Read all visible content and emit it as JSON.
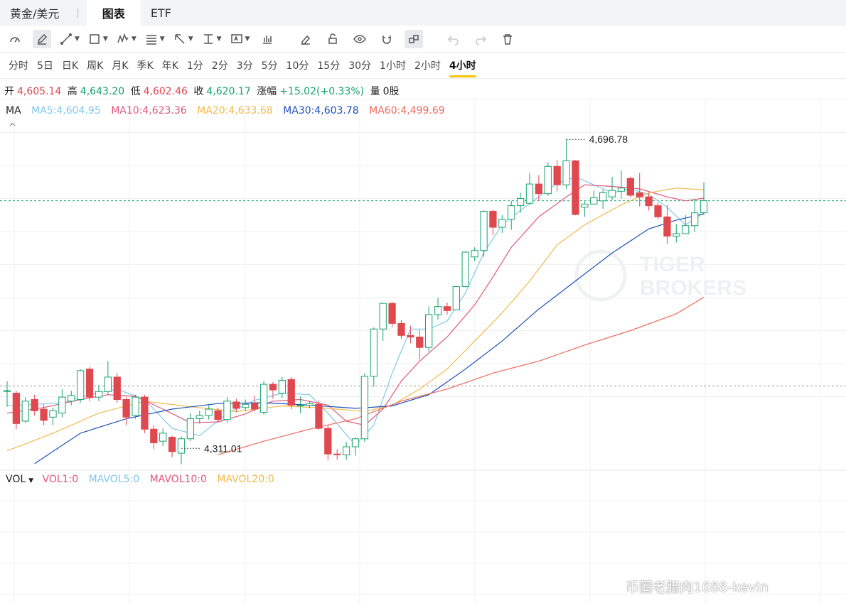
{
  "tabs": [
    {
      "label": "黄金/美元"
    },
    {
      "label": "图表"
    },
    {
      "label": "ETF"
    }
  ],
  "tab_separator": "|",
  "toolbar_icons": [
    "gauge-icon",
    "pencil-icon",
    "trend-line-icon",
    "rectangle-icon",
    "pattern-icon",
    "fib-icon",
    "arrow-icon",
    "measure-icon",
    "text-icon",
    "indicator-icon",
    "eraser-icon",
    "lock-icon",
    "eye-icon",
    "magnet-icon",
    "link-icon",
    "undo-icon",
    "redo-icon",
    "trash-icon"
  ],
  "periods": [
    "分时",
    "5日",
    "日K",
    "周K",
    "月K",
    "季K",
    "年K",
    "1分",
    "2分",
    "3分",
    "5分",
    "10分",
    "15分",
    "30分",
    "1小时",
    "2小时",
    "4小时"
  ],
  "active_period": "4小时",
  "ohlc": {
    "open_label": "开",
    "open": "4,605.14",
    "high_label": "高",
    "high": "4,643.20",
    "low_label": "低",
    "low": "4,602.46",
    "close_label": "收",
    "close": "4,620.17",
    "change_label": "涨幅",
    "change": "+15.02(+0.33%)",
    "volume_label": "量",
    "volume": "0股"
  },
  "ma_legend": {
    "title": "MA",
    "ma5": "MA5:4,604.95",
    "ma10": "MA10:4,623.36",
    "ma20": "MA20:4,633.68",
    "ma30": "MA30:4,603.78",
    "ma60": "MA60:4,499.69"
  },
  "vol_legend": {
    "title": "VOL",
    "vol1": "VOL1:0",
    "mavol5": "MAVOL5:0",
    "mavol10": "MAVOL10:0",
    "mavol20": "MAVOL20:0"
  },
  "collapse_glyph": "^",
  "watermark": "币圈老腊肉1688-kevin",
  "colors": {
    "up": "#16a36c",
    "down": "#e0484f",
    "ma5": "#7fc8ec",
    "ma10": "#e0577a",
    "ma20": "#f2b94d",
    "ma30": "#1d4fb8",
    "ma60": "#ee6b5c",
    "accent": "#f5c400"
  },
  "chart_data": {
    "type": "candlestick",
    "y_range": [
      4290,
      4720
    ],
    "max_label": "4,696.78",
    "min_label": "4,311.01",
    "max_value": 4696.78,
    "min_value": 4311.01,
    "candles": [
      {
        "o": 4383,
        "c": 4383,
        "h": 4395,
        "l": 4363
      },
      {
        "o": 4380,
        "c": 4342,
        "h": 4383,
        "l": 4335
      },
      {
        "o": 4345,
        "c": 4370,
        "h": 4375,
        "l": 4343
      },
      {
        "o": 4372,
        "c": 4358,
        "h": 4378,
        "l": 4352
      },
      {
        "o": 4360,
        "c": 4346,
        "h": 4366,
        "l": 4340
      },
      {
        "o": 4350,
        "c": 4358,
        "h": 4362,
        "l": 4340
      },
      {
        "o": 4355,
        "c": 4375,
        "h": 4385,
        "l": 4350
      },
      {
        "o": 4370,
        "c": 4377,
        "h": 4383,
        "l": 4365
      },
      {
        "o": 4372,
        "c": 4408,
        "h": 4410,
        "l": 4368
      },
      {
        "o": 4410,
        "c": 4375,
        "h": 4413,
        "l": 4370
      },
      {
        "o": 4375,
        "c": 4382,
        "h": 4390,
        "l": 4370
      },
      {
        "o": 4382,
        "c": 4400,
        "h": 4420,
        "l": 4378
      },
      {
        "o": 4400,
        "c": 4372,
        "h": 4405,
        "l": 4368
      },
      {
        "o": 4372,
        "c": 4350,
        "h": 4375,
        "l": 4340
      },
      {
        "o": 4352,
        "c": 4375,
        "h": 4378,
        "l": 4348
      },
      {
        "o": 4375,
        "c": 4335,
        "h": 4378,
        "l": 4330
      },
      {
        "o": 4335,
        "c": 4318,
        "h": 4340,
        "l": 4310
      },
      {
        "o": 4320,
        "c": 4330,
        "h": 4336,
        "l": 4314
      },
      {
        "o": 4325,
        "c": 4307,
        "h": 4327,
        "l": 4300
      },
      {
        "o": 4305,
        "c": 4323,
        "h": 4326,
        "l": 4291
      },
      {
        "o": 4323,
        "c": 4348,
        "h": 4355,
        "l": 4320
      },
      {
        "o": 4348,
        "c": 4352,
        "h": 4358,
        "l": 4342
      },
      {
        "o": 4352,
        "c": 4360,
        "h": 4365,
        "l": 4347
      },
      {
        "o": 4358,
        "c": 4347,
        "h": 4362,
        "l": 4344
      },
      {
        "o": 4347,
        "c": 4370,
        "h": 4375,
        "l": 4343
      },
      {
        "o": 4369,
        "c": 4361,
        "h": 4373,
        "l": 4356
      },
      {
        "o": 4362,
        "c": 4366,
        "h": 4372,
        "l": 4358
      },
      {
        "o": 4367,
        "c": 4360,
        "h": 4377,
        "l": 4357
      },
      {
        "o": 4356,
        "c": 4391,
        "h": 4395,
        "l": 4353
      },
      {
        "o": 4391,
        "c": 4384,
        "h": 4394,
        "l": 4373
      },
      {
        "o": 4380,
        "c": 4396,
        "h": 4400,
        "l": 4374
      },
      {
        "o": 4397,
        "c": 4365,
        "h": 4400,
        "l": 4360
      },
      {
        "o": 4365,
        "c": 4365,
        "h": 4376,
        "l": 4355
      },
      {
        "o": 4365,
        "c": 4367,
        "h": 4370,
        "l": 4361
      },
      {
        "o": 4366,
        "c": 4336,
        "h": 4371,
        "l": 4334
      },
      {
        "o": 4336,
        "c": 4304,
        "h": 4340,
        "l": 4296
      },
      {
        "o": 4304,
        "c": 4303,
        "h": 4310,
        "l": 4297
      },
      {
        "o": 4303,
        "c": 4313,
        "h": 4319,
        "l": 4297
      },
      {
        "o": 4313,
        "c": 4323,
        "h": 4325,
        "l": 4302
      },
      {
        "o": 4323,
        "c": 4401,
        "h": 4405,
        "l": 4319
      },
      {
        "o": 4401,
        "c": 4460,
        "h": 4462,
        "l": 4388
      },
      {
        "o": 4460,
        "c": 4492,
        "h": 4493,
        "l": 4445
      },
      {
        "o": 4492,
        "c": 4467,
        "h": 4494,
        "l": 4462
      },
      {
        "o": 4467,
        "c": 4452,
        "h": 4471,
        "l": 4448
      },
      {
        "o": 4452,
        "c": 4450,
        "h": 4464,
        "l": 4442
      },
      {
        "o": 4450,
        "c": 4437,
        "h": 4459,
        "l": 4422
      },
      {
        "o": 4437,
        "c": 4478,
        "h": 4488,
        "l": 4432
      },
      {
        "o": 4478,
        "c": 4488,
        "h": 4499,
        "l": 4472
      },
      {
        "o": 4488,
        "c": 4483,
        "h": 4493,
        "l": 4478
      },
      {
        "o": 4484,
        "c": 4513,
        "h": 4514,
        "l": 4484
      },
      {
        "o": 4513,
        "c": 4556,
        "h": 4557,
        "l": 4512
      },
      {
        "o": 4550,
        "c": 4558,
        "h": 4562,
        "l": 4545
      },
      {
        "o": 4558,
        "c": 4607,
        "h": 4608,
        "l": 4550
      },
      {
        "o": 4607,
        "c": 4587,
        "h": 4609,
        "l": 4577
      },
      {
        "o": 4587,
        "c": 4597,
        "h": 4602,
        "l": 4580
      },
      {
        "o": 4597,
        "c": 4614,
        "h": 4620,
        "l": 4584
      },
      {
        "o": 4614,
        "c": 4623,
        "h": 4630,
        "l": 4605
      },
      {
        "o": 4617,
        "c": 4641,
        "h": 4655,
        "l": 4615
      },
      {
        "o": 4641,
        "c": 4629,
        "h": 4652,
        "l": 4620
      },
      {
        "o": 4629,
        "c": 4663,
        "h": 4668,
        "l": 4626
      },
      {
        "o": 4663,
        "c": 4640,
        "h": 4671,
        "l": 4632
      },
      {
        "o": 4640,
        "c": 4670,
        "h": 4697,
        "l": 4635
      },
      {
        "o": 4670,
        "c": 4603,
        "h": 4671,
        "l": 4602
      },
      {
        "o": 4612,
        "c": 4616,
        "h": 4620,
        "l": 4600
      },
      {
        "o": 4616,
        "c": 4624,
        "h": 4633,
        "l": 4616
      },
      {
        "o": 4620,
        "c": 4630,
        "h": 4634,
        "l": 4610
      },
      {
        "o": 4625,
        "c": 4633,
        "h": 4650,
        "l": 4621
      },
      {
        "o": 4632,
        "c": 4636,
        "h": 4658,
        "l": 4623
      },
      {
        "o": 4648,
        "c": 4627,
        "h": 4650,
        "l": 4624
      },
      {
        "o": 4630,
        "c": 4625,
        "h": 4655,
        "l": 4613
      },
      {
        "o": 4625,
        "c": 4614,
        "h": 4630,
        "l": 4608
      },
      {
        "o": 4614,
        "c": 4600,
        "h": 4618,
        "l": 4597
      },
      {
        "o": 4600,
        "c": 4576,
        "h": 4615,
        "l": 4566
      },
      {
        "o": 4576,
        "c": 4579,
        "h": 4591,
        "l": 4568
      },
      {
        "o": 4579,
        "c": 4589,
        "h": 4602,
        "l": 4579
      },
      {
        "o": 4589,
        "c": 4605,
        "h": 4623,
        "l": 4581
      },
      {
        "o": 4605.14,
        "c": 4620.17,
        "h": 4643.2,
        "l": 4602.46
      }
    ],
    "ma_series": [
      {
        "name": "MA5",
        "points": [
          [
            0,
            4364
          ],
          [
            3,
            4366
          ],
          [
            6,
            4368
          ],
          [
            9,
            4378
          ],
          [
            12,
            4385
          ],
          [
            15,
            4372
          ],
          [
            18,
            4336
          ],
          [
            21,
            4327
          ],
          [
            24,
            4355
          ],
          [
            27,
            4371
          ],
          [
            30,
            4380
          ],
          [
            33,
            4378
          ],
          [
            35,
            4355
          ],
          [
            38,
            4315
          ],
          [
            40,
            4340
          ],
          [
            42,
            4405
          ],
          [
            44,
            4460
          ],
          [
            46,
            4460
          ],
          [
            48,
            4470
          ],
          [
            50,
            4505
          ],
          [
            52,
            4555
          ],
          [
            54,
            4590
          ],
          [
            56,
            4608
          ],
          [
            58,
            4625
          ],
          [
            60,
            4642
          ],
          [
            62,
            4650
          ],
          [
            64,
            4640
          ],
          [
            66,
            4630
          ],
          [
            68,
            4635
          ],
          [
            70,
            4628
          ],
          [
            72,
            4612
          ],
          [
            74,
            4590
          ],
          [
            76,
            4604.95
          ]
        ]
      },
      {
        "name": "MA10",
        "points": [
          [
            0,
            4355
          ],
          [
            4,
            4362
          ],
          [
            8,
            4372
          ],
          [
            11,
            4378
          ],
          [
            14,
            4376
          ],
          [
            17,
            4360
          ],
          [
            20,
            4343
          ],
          [
            23,
            4344
          ],
          [
            26,
            4354
          ],
          [
            29,
            4370
          ],
          [
            32,
            4372
          ],
          [
            35,
            4365
          ],
          [
            37,
            4345
          ],
          [
            39,
            4340
          ],
          [
            41,
            4360
          ],
          [
            43,
            4395
          ],
          [
            45,
            4420
          ],
          [
            48,
            4450
          ],
          [
            51,
            4490
          ],
          [
            53,
            4525
          ],
          [
            55,
            4562
          ],
          [
            58,
            4600
          ],
          [
            61,
            4625
          ],
          [
            63,
            4640
          ],
          [
            66,
            4638
          ],
          [
            69,
            4635
          ],
          [
            72,
            4625
          ],
          [
            74,
            4620
          ],
          [
            76,
            4623.36
          ]
        ]
      },
      {
        "name": "MA20",
        "points": [
          [
            0,
            4308
          ],
          [
            5,
            4330
          ],
          [
            10,
            4355
          ],
          [
            15,
            4370
          ],
          [
            20,
            4363
          ],
          [
            25,
            4357
          ],
          [
            30,
            4364
          ],
          [
            35,
            4361
          ],
          [
            39,
            4357
          ],
          [
            42,
            4365
          ],
          [
            45,
            4385
          ],
          [
            48,
            4410
          ],
          [
            51,
            4445
          ],
          [
            54,
            4480
          ],
          [
            57,
            4520
          ],
          [
            60,
            4565
          ],
          [
            63,
            4590
          ],
          [
            67,
            4615
          ],
          [
            70,
            4630
          ],
          [
            73,
            4636
          ],
          [
            76,
            4633.68
          ]
        ]
      },
      {
        "name": "MA30",
        "points": [
          [
            3,
            4292
          ],
          [
            8,
            4330
          ],
          [
            13,
            4348
          ],
          [
            18,
            4360
          ],
          [
            23,
            4367
          ],
          [
            28,
            4368
          ],
          [
            33,
            4365
          ],
          [
            38,
            4361
          ],
          [
            42,
            4364
          ],
          [
            46,
            4378
          ],
          [
            50,
            4410
          ],
          [
            54,
            4445
          ],
          [
            58,
            4485
          ],
          [
            62,
            4520
          ],
          [
            66,
            4555
          ],
          [
            70,
            4585
          ],
          [
            73,
            4596
          ],
          [
            76,
            4603.78
          ]
        ]
      },
      {
        "name": "MA60",
        "points": [
          [
            23,
            4303
          ],
          [
            28,
            4320
          ],
          [
            33,
            4335
          ],
          [
            38,
            4348
          ],
          [
            43,
            4370
          ],
          [
            48,
            4385
          ],
          [
            53,
            4405
          ],
          [
            58,
            4420
          ],
          [
            63,
            4440
          ],
          [
            68,
            4458
          ],
          [
            73,
            4479
          ],
          [
            76,
            4499.69
          ]
        ]
      }
    ],
    "grid": true
  }
}
